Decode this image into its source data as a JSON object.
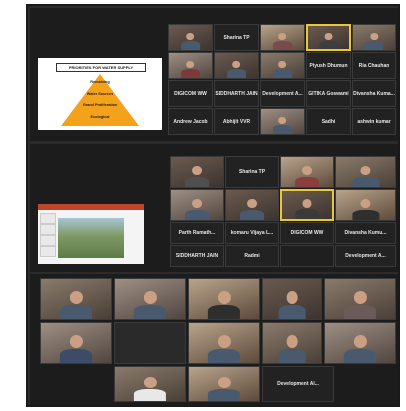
{
  "slide_left": {
    "title": "PRIORITIES FOR WATER SUPPLY",
    "levels": [
      "Remaining",
      "Water Sources",
      "Grand Proliferation",
      "Ecological"
    ]
  },
  "grid1": {
    "names": [
      "Sharina TP",
      "Piyush Dhumun",
      "Ria Chauhan",
      "DIGICOM WW",
      "SIDDHARTH JAIN",
      "Development A...",
      "GITIKA Goswami",
      "Divansha Kuma...",
      "Andrew Jacob",
      "Abhijit VVR",
      "Sadhi",
      "ashwin kumar"
    ]
  },
  "grid2": {
    "names": [
      "Sharina TP",
      "Parth Ramath...",
      "komaru Vijaya L...",
      "DIGICOM WW",
      "Divansha Kumu...",
      "SIDDHARTH JAIN",
      "Radmi",
      "Development A..."
    ]
  },
  "grid3": {
    "names": [
      "Development Al..."
    ]
  }
}
